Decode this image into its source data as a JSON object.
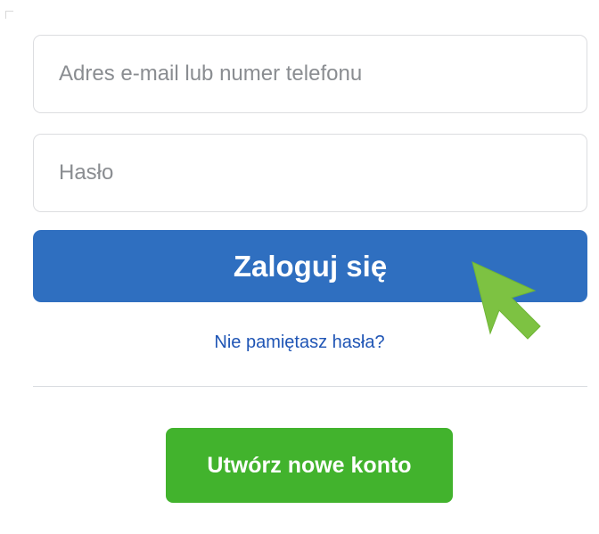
{
  "login_form": {
    "email_placeholder": "Adres e-mail lub numer telefonu",
    "password_placeholder": "Hasło",
    "login_button_label": "Zaloguj się",
    "forgot_password_label": "Nie pamiętasz hasła?",
    "create_account_label": "Utwórz nowe konto"
  },
  "icons": {
    "pointer": "arrow-cursor-icon"
  },
  "colors": {
    "primary_blue": "#2f6fc0",
    "link_blue": "#1f55b5",
    "create_green": "#42b32d",
    "cursor_green": "#7dc242"
  }
}
